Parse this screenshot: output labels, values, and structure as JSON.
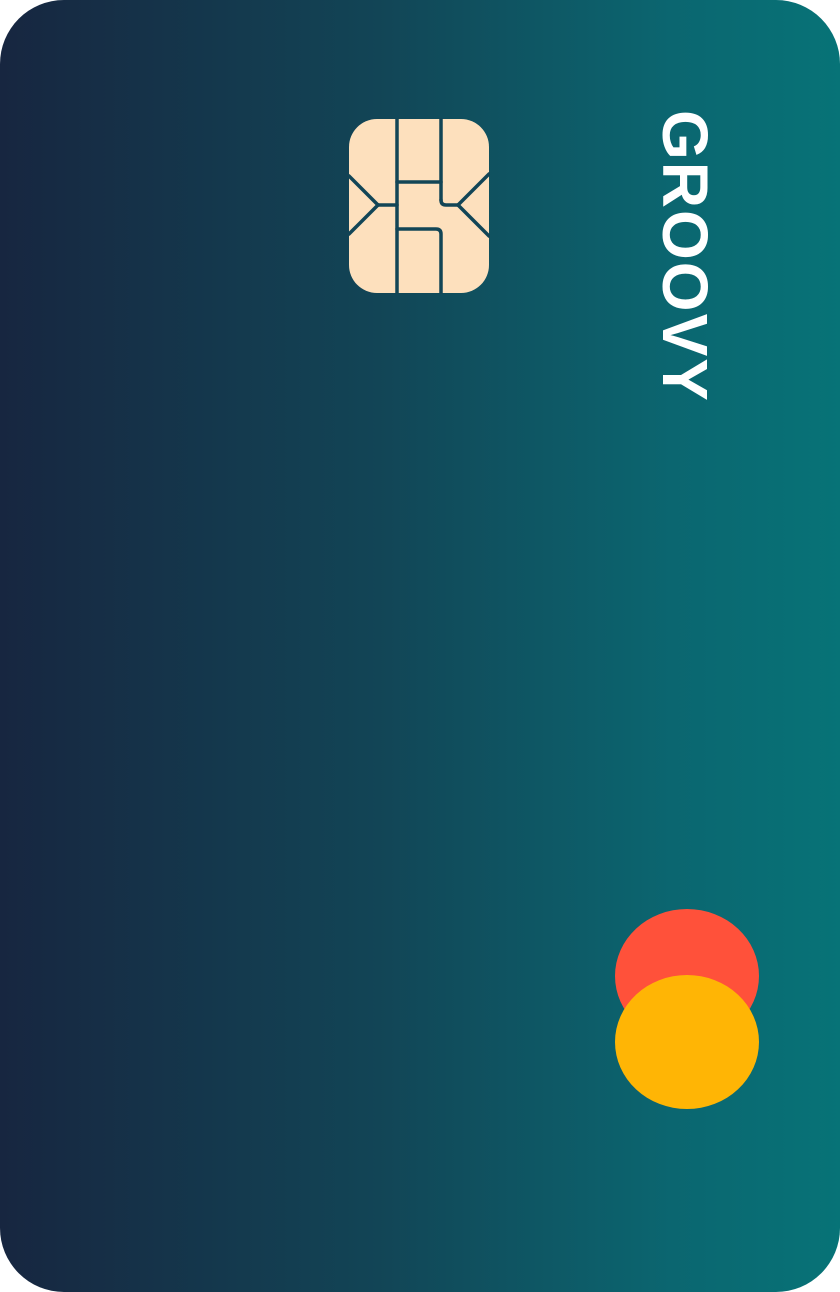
{
  "card": {
    "brand_name": "GROOVY",
    "colors": {
      "gradient_start": "#172640",
      "gradient_end": "#077377",
      "brand_text": "#ffffff",
      "chip_fill": "#fde0bd",
      "chip_lines": "#124556",
      "network_circle_top": "#ff513a",
      "network_circle_bottom": "#ffb505"
    },
    "icons": {
      "chip": "emv-chip-icon",
      "network": "card-network-logo-icon"
    }
  }
}
